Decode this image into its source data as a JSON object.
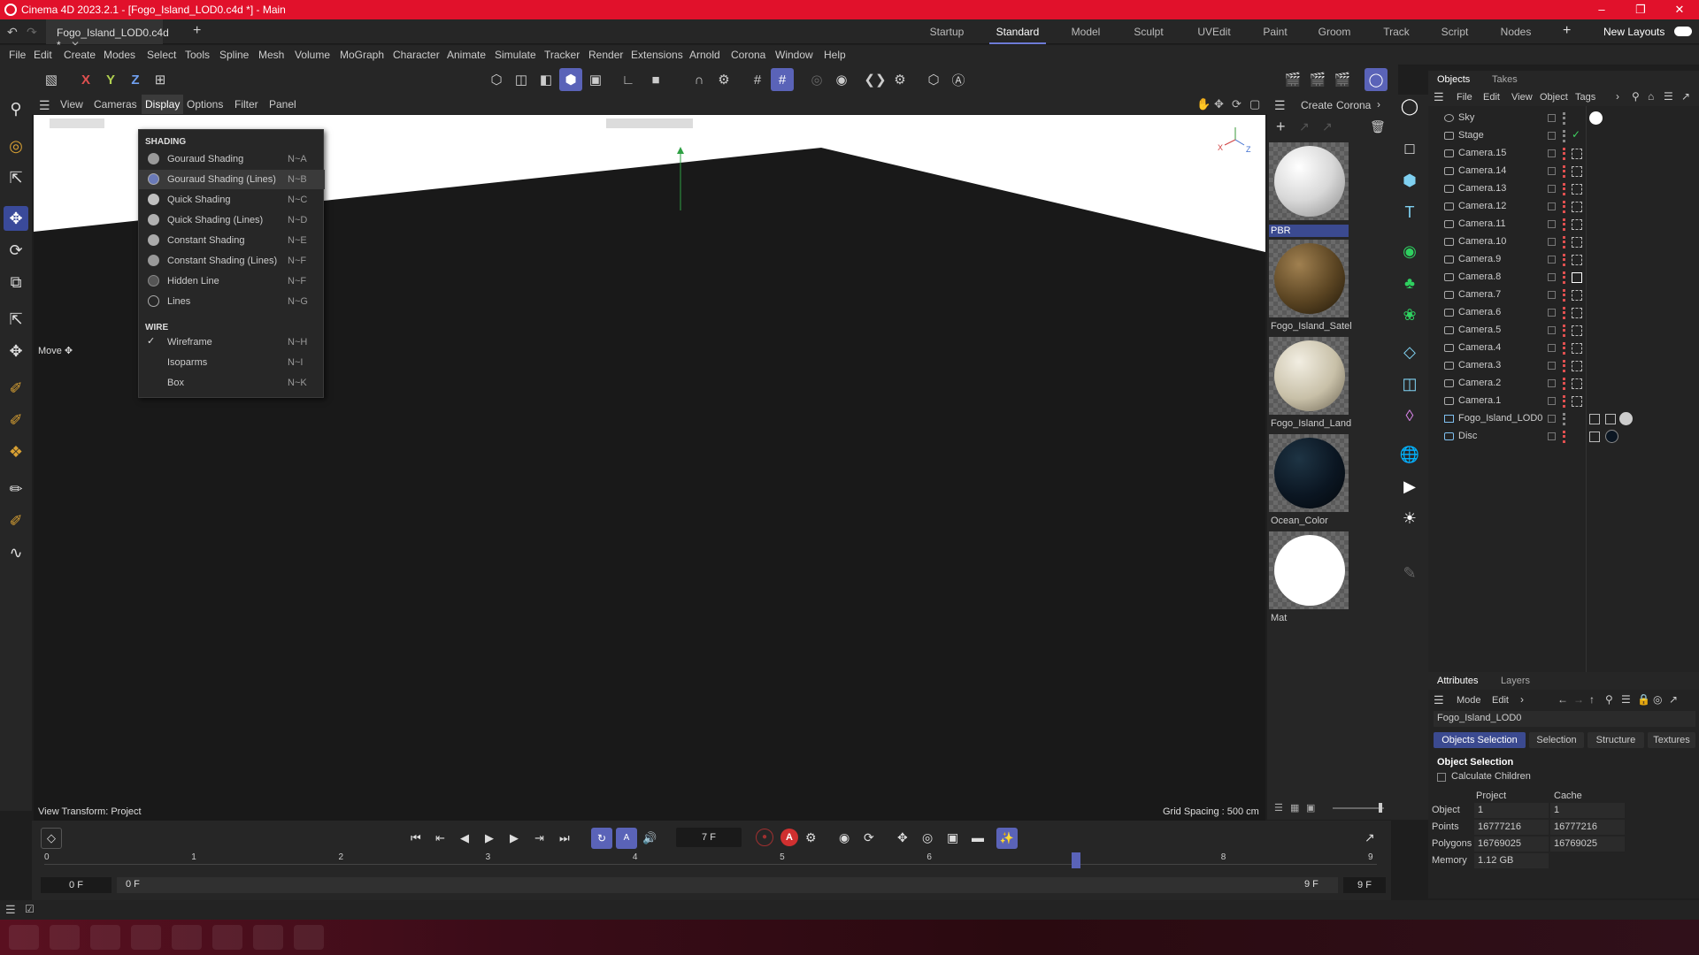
{
  "title": "Cinema 4D 2023.2.1 - [Fogo_Island_LOD0.c4d *] - Main",
  "doc_tab": "Fogo_Island_LOD0.c4d *",
  "layouts": [
    "Startup",
    "Standard",
    "Model",
    "Sculpt",
    "UVEdit",
    "Paint",
    "Groom",
    "Track",
    "Script",
    "Nodes"
  ],
  "new_layouts": "New Layouts",
  "menu": [
    "File",
    "Edit",
    "Create",
    "Modes",
    "Select",
    "Tools",
    "Spline",
    "Mesh",
    "Volume",
    "MoGraph",
    "Character",
    "Animate",
    "Simulate",
    "Tracker",
    "Render",
    "Extensions",
    "Arnold",
    "Corona",
    "Window",
    "Help"
  ],
  "axes": [
    "X",
    "Y",
    "Z"
  ],
  "viewport_menu": [
    "View",
    "Cameras",
    "Display",
    "Options",
    "Filter",
    "Panel"
  ],
  "move_label": "Move",
  "display_menu": {
    "shading_head": "SHADING",
    "shading": [
      {
        "label": "Gouraud Shading",
        "key": "N~A"
      },
      {
        "label": "Gouraud Shading (Lines)",
        "key": "N~B"
      },
      {
        "label": "Quick Shading",
        "key": "N~C"
      },
      {
        "label": "Quick Shading (Lines)",
        "key": "N~D"
      },
      {
        "label": "Constant Shading",
        "key": "N~E"
      },
      {
        "label": "Constant Shading (Lines)",
        "key": "N~F"
      },
      {
        "label": "Hidden Line",
        "key": "N~F"
      },
      {
        "label": "Lines",
        "key": "N~G"
      }
    ],
    "wire_head": "WIRE",
    "wire": [
      {
        "label": "Wireframe",
        "key": "N~H"
      },
      {
        "label": "Isoparms",
        "key": "N~I"
      },
      {
        "label": "Box",
        "key": "N~K"
      }
    ]
  },
  "vp_status_left": "View Transform: Project",
  "vp_status_right": "Grid Spacing : 500 cm",
  "mat_menu": [
    "Create",
    "Corona"
  ],
  "materials": [
    {
      "name": "PBR",
      "color": "#e8e8e8"
    },
    {
      "name": "Fogo_Island_Satel",
      "color": "#6a5230"
    },
    {
      "name": "Fogo_Island_Land",
      "color": "#d8d2c0"
    },
    {
      "name": "Ocean_Color",
      "color": "#0d1a26"
    },
    {
      "name": "Mat",
      "color": "#ffffff"
    }
  ],
  "obj_tabs": [
    "Objects",
    "Takes"
  ],
  "obj_menu": [
    "File",
    "Edit",
    "View",
    "Object",
    "Tags"
  ],
  "objects": [
    "Sky",
    "Stage",
    "Camera.15",
    "Camera.14",
    "Camera.13",
    "Camera.12",
    "Camera.11",
    "Camera.10",
    "Camera.9",
    "Camera.8",
    "Camera.7",
    "Camera.6",
    "Camera.5",
    "Camera.4",
    "Camera.3",
    "Camera.2",
    "Camera.1",
    "Fogo_Island_LOD0",
    "Disc"
  ],
  "attr_tabs": [
    "Attributes",
    "Layers"
  ],
  "attr_menu": [
    "Mode",
    "Edit"
  ],
  "attr_object": "Fogo_Island_LOD0",
  "attr_subtabs": [
    "Objects Selection",
    "Selection",
    "Structure",
    "Textures"
  ],
  "attr_section": "Object Selection",
  "calc_children": "Calculate Children",
  "attr_table": {
    "cols": [
      "Project",
      "Cache"
    ],
    "rows": [
      {
        "label": "Object",
        "project": "1",
        "cache": "1"
      },
      {
        "label": "Points",
        "project": "16777216",
        "cache": "16777216"
      },
      {
        "label": "Polygons",
        "project": "16769025",
        "cache": "16769025"
      },
      {
        "label": "Memory",
        "project": "1.12 GB",
        "cache": ""
      }
    ]
  },
  "timeline": {
    "frame": "7 F",
    "ticks": [
      "0",
      "1",
      "2",
      "3",
      "4",
      "5",
      "6",
      "7",
      "8",
      "9"
    ],
    "start": "0 F",
    "start2": "0 F",
    "end": "9 F",
    "end2": "9 F",
    "current_fraction": 0.7778
  }
}
